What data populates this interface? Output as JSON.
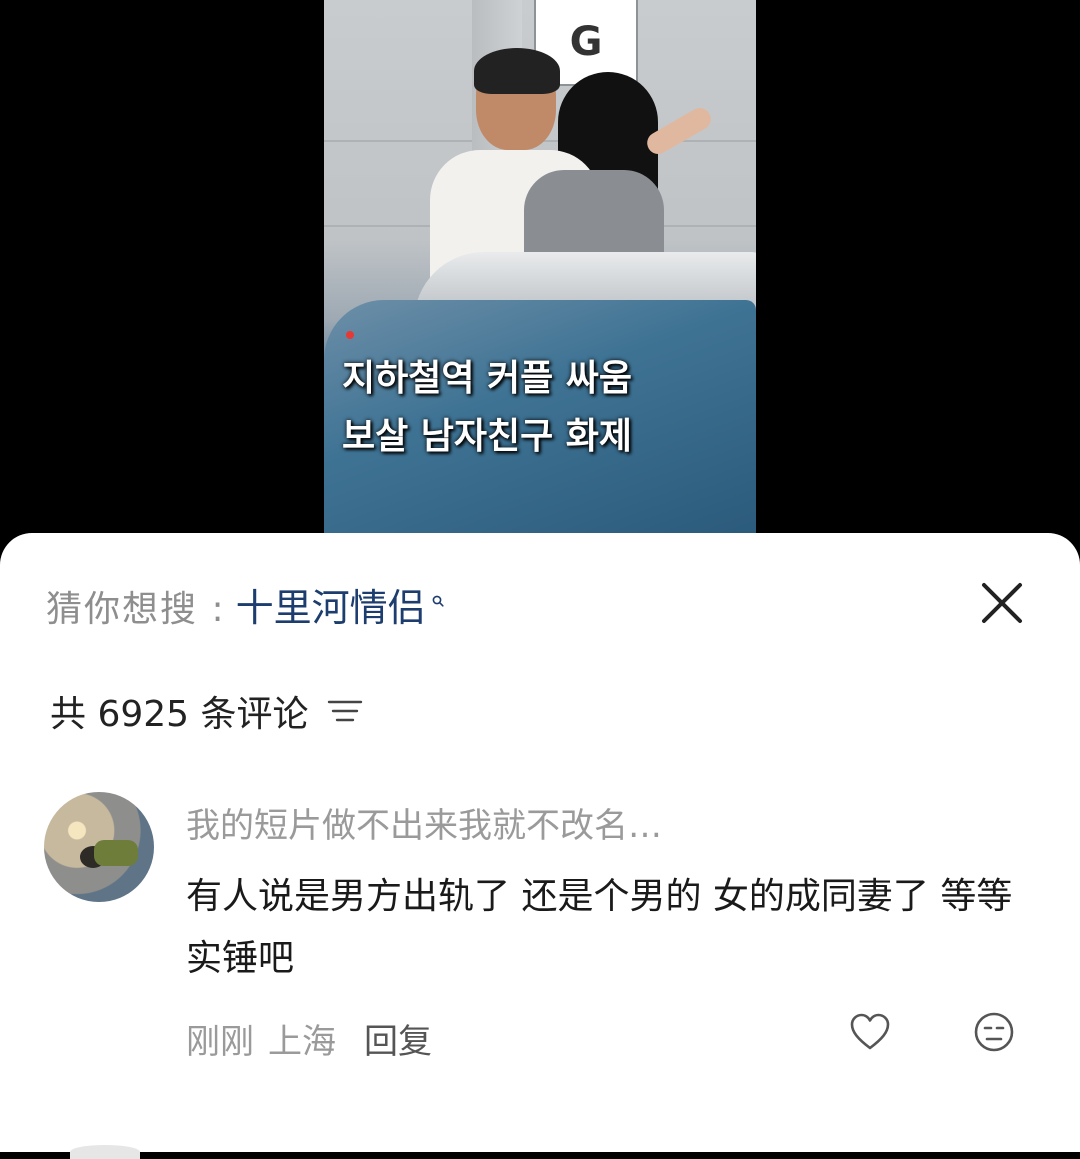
{
  "video": {
    "sign_letter": "G",
    "caption_line1": "지하철역 커플 싸움",
    "caption_line2": "보살 남자친구 화제"
  },
  "search": {
    "prefix": "猜你想搜 :",
    "term": "十里河情侣",
    "icon": "search-icon"
  },
  "comments_header": {
    "count_label": "共 6925 条评论",
    "sort_icon": "sort-lines-icon"
  },
  "comment": {
    "username": "我的短片做不出来我就不改名…",
    "text": "有人说是男方出轨了 还是个男的 女的成同妻了 等等实锤吧",
    "time": "刚刚",
    "location": "上海",
    "reply_label": "回复"
  },
  "colors": {
    "search_term": "#1c3d6e",
    "muted_text": "#9a9a9a",
    "primary_text": "#1a1a1a"
  }
}
